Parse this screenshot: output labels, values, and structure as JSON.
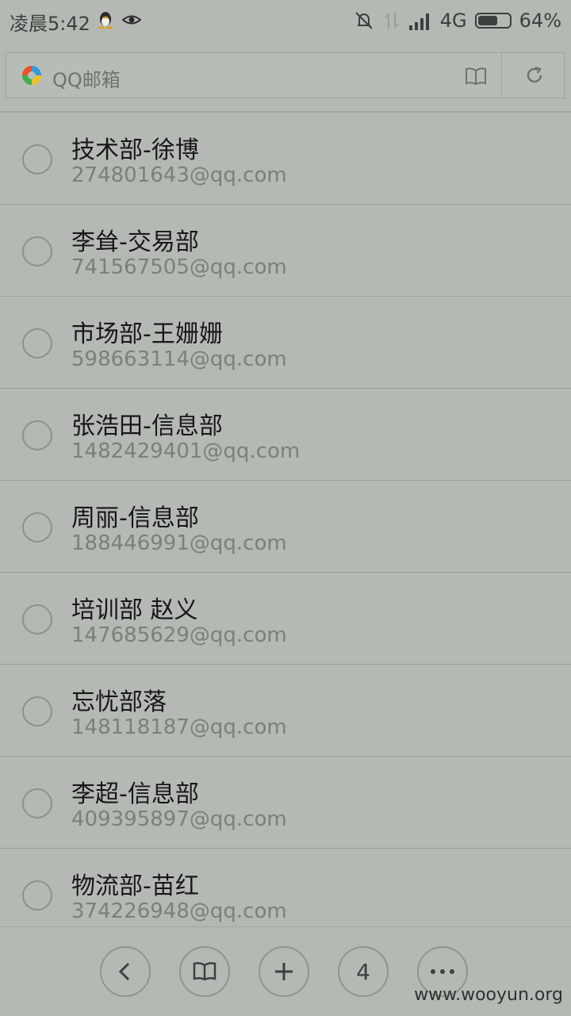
{
  "status_bar": {
    "time": "凌晨5:42",
    "network": "4G",
    "battery_text": "64%",
    "battery_level": 0.64
  },
  "address_bar": {
    "title": "QQ邮箱",
    "icons": [
      "qq-mail-logo-icon",
      "reader-book-icon",
      "refresh-icon"
    ]
  },
  "contacts": [
    {
      "name": "技术部-徐博",
      "email": "274801643@qq.com"
    },
    {
      "name": "李耸-交易部",
      "email": "741567505@qq.com"
    },
    {
      "name": "市场部-王姗姗",
      "email": "598663114@qq.com"
    },
    {
      "name": "张浩田-信息部",
      "email": "1482429401@qq.com"
    },
    {
      "name": "周丽-信息部",
      "email": "188446991@qq.com"
    },
    {
      "name": "培训部 赵义",
      "email": "147685629@qq.com"
    },
    {
      "name": "忘忧部落",
      "email": "148118187@qq.com"
    },
    {
      "name": "李超-信息部",
      "email": "409395897@qq.com"
    },
    {
      "name": "物流部-苗红",
      "email": "374226948@qq.com"
    }
  ],
  "toolbar": {
    "tab_count": "4",
    "icons": [
      "back-icon",
      "bookmarks-icon",
      "new-tab-icon",
      "tabs-count",
      "more-icon"
    ]
  },
  "watermark": "www.wooyun.org"
}
